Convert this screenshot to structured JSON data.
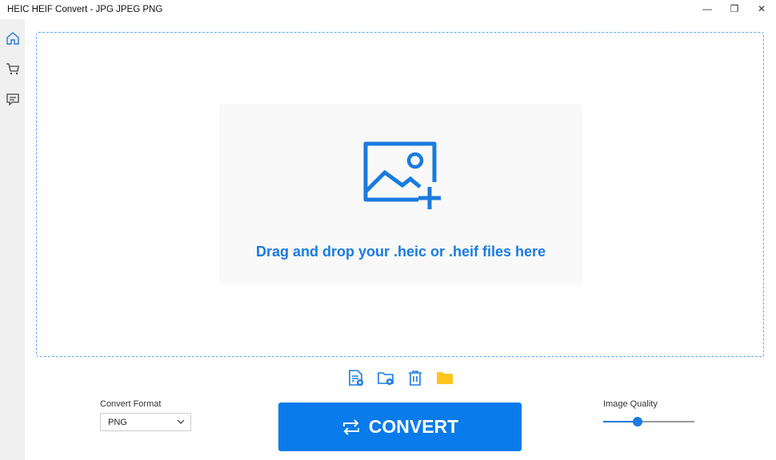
{
  "window": {
    "title": "HEIC HEIF Convert - JPG JPEG PNG"
  },
  "sidebar": {
    "items": [
      {
        "icon": "home-icon"
      },
      {
        "icon": "cart-icon"
      },
      {
        "icon": "feedback-icon"
      }
    ]
  },
  "dropzone": {
    "text": "Drag and drop your .heic or .heif files here",
    "icon": "add-image-icon"
  },
  "toolbar": [
    "add-file-icon",
    "add-folder-icon",
    "delete-icon",
    "open-folder-icon"
  ],
  "format": {
    "label": "Convert Format",
    "value": "PNG"
  },
  "convert": {
    "label": "CONVERT"
  },
  "quality": {
    "label": "Image Quality",
    "value_percent": 38
  },
  "colors": {
    "accent": "#0a7bea",
    "folder": "#ffc61a"
  }
}
